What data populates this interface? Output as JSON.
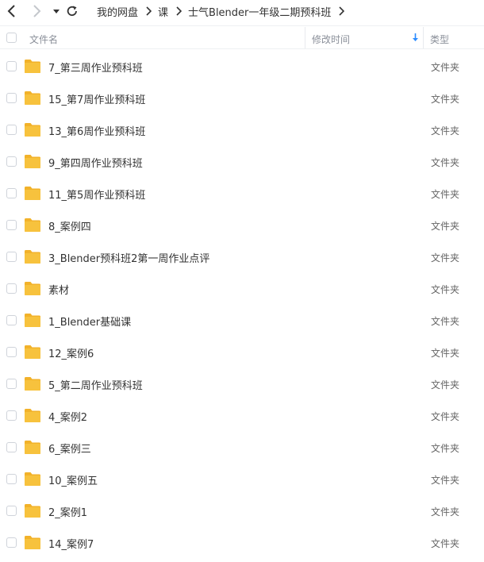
{
  "breadcrumb": [
    "我的网盘",
    "课",
    "士气Blender一年级二期预科班"
  ],
  "columns": {
    "name": "文件名",
    "modified": "修改时间",
    "type": "类型"
  },
  "colors": {
    "sort_arrow": "#2b8cff",
    "folder": "#f7c23d",
    "folder_back": "#f2b22a"
  },
  "files": [
    {
      "name": "7_第三周作业预科班",
      "type": "文件夹"
    },
    {
      "name": "15_第7周作业预科班",
      "type": "文件夹"
    },
    {
      "name": "13_第6周作业预科班",
      "type": "文件夹"
    },
    {
      "name": "9_第四周作业预科班",
      "type": "文件夹"
    },
    {
      "name": "11_第5周作业预科班",
      "type": "文件夹"
    },
    {
      "name": "8_案例四",
      "type": "文件夹"
    },
    {
      "name": "3_Blender预科班2第一周作业点评",
      "type": "文件夹"
    },
    {
      "name": "素材",
      "type": "文件夹"
    },
    {
      "name": "1_Blender基础课",
      "type": "文件夹"
    },
    {
      "name": "12_案例6",
      "type": "文件夹"
    },
    {
      "name": "5_第二周作业预科班",
      "type": "文件夹"
    },
    {
      "name": "4_案例2",
      "type": "文件夹"
    },
    {
      "name": "6_案例三",
      "type": "文件夹"
    },
    {
      "name": "10_案例五",
      "type": "文件夹"
    },
    {
      "name": "2_案例1",
      "type": "文件夹"
    },
    {
      "name": "14_案例7",
      "type": "文件夹"
    }
  ]
}
